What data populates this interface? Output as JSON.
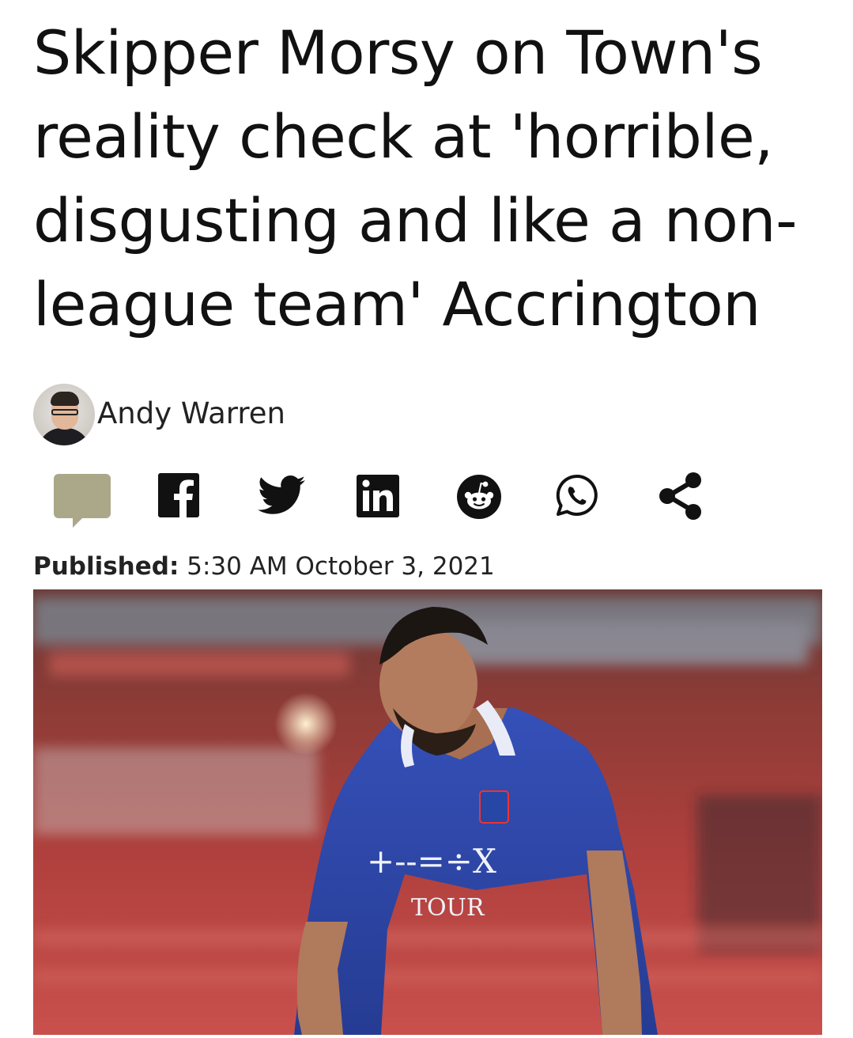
{
  "article": {
    "headline": "Skipper Morsy on Town's reality check at 'horrible, disgusting and like a non-league team' Accrington",
    "author": {
      "name": "Andy Warren"
    },
    "published": {
      "label": "Published:",
      "value": "5:30 AM October 3, 2021"
    },
    "hero_image": {
      "jersey_text": "TOUR",
      "sponsor_mark": "+--=÷X"
    }
  },
  "share": {
    "icons": [
      "comment-icon",
      "facebook-icon",
      "twitter-icon",
      "linkedin-icon",
      "reddit-icon",
      "whatsapp-icon",
      "share-icon"
    ]
  },
  "colors": {
    "text": "#111111",
    "comment_icon": "#aaa889",
    "social_icon": "#111111",
    "kit_blue": "#2f46a8"
  }
}
